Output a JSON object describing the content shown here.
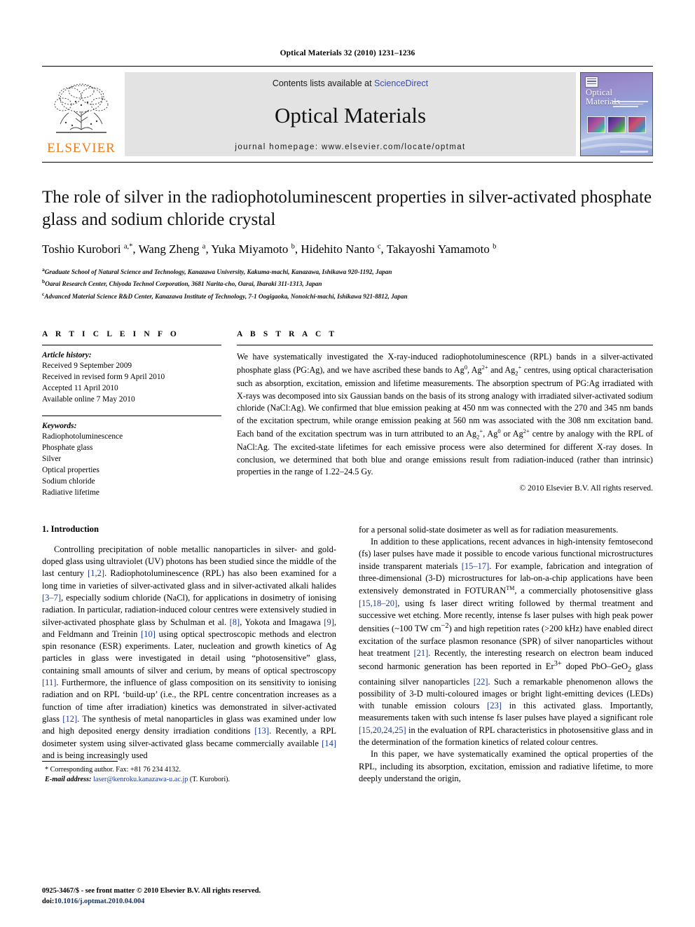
{
  "running_head": "Optical Materials 32 (2010) 1231–1236",
  "masthead": {
    "contents_prefix": "Contents lists available at ",
    "sciencedirect": "ScienceDirect",
    "journal_title": "Optical Materials",
    "homepage": "journal homepage: www.elsevier.com/locate/optmat",
    "publisher": "ELSEVIER",
    "cover_title": "Optical Materials",
    "accent_orange": "#F07D1A",
    "link_blue": "#3B4CA8"
  },
  "article": {
    "title": "The role of silver in the radiophotoluminescent properties in silver-activated phosphate glass and sodium chloride crystal",
    "authors_html": "Toshio Kurobori <sup>a,*</sup>, Wang Zheng <sup>a</sup>, Yuka Miyamoto <sup>b</sup>, Hidehito Nanto <sup>c</sup>, Takayoshi Yamamoto <sup>b</sup>",
    "affiliations": [
      {
        "marker": "a",
        "text": "Graduate School of Natural Science and Technology, Kanazawa University, Kakuma-machi, Kanazawa, Ishikawa 920-1192, Japan"
      },
      {
        "marker": "b",
        "text": "Oarai Research Center, Chiyoda Technol Corporation, 3681 Narita-cho, Oarai, Ibaraki 311-1313, Japan"
      },
      {
        "marker": "c",
        "text": "Advanced Material Science R&D Center, Kanazawa Institute of Technology, 7-1 Oogigaoka, Nonoichi-machi, Ishikawa 921-8812, Japan"
      }
    ]
  },
  "article_info": {
    "heading": "A R T I C L E   I N F O",
    "history_label": "Article history:",
    "history": [
      "Received 9 September 2009",
      "Received in revised form 9 April 2010",
      "Accepted 11 April 2010",
      "Available online 7 May 2010"
    ],
    "keywords_label": "Keywords:",
    "keywords": [
      "Radiophotoluminescence",
      "Phosphate glass",
      "Silver",
      "Optical properties",
      "Sodium chloride",
      "Radiative lifetime"
    ]
  },
  "abstract": {
    "heading": "A B S T R A C T",
    "text_html": "We have systematically investigated the X-ray-induced radiophotoluminescence (RPL) bands in a silver-activated phosphate glass (PG:Ag), and we have ascribed these bands to Ag<sup>0</sup>, Ag<sup>2+</sup> and Ag<sub>2</sub><sup>+</sup> centres, using optical characterisation such as absorption, excitation, emission and lifetime measurements. The absorption spectrum of PG:Ag irradiated with X-rays was decomposed into six Gaussian bands on the basis of its strong analogy with irradiated silver-activated sodium chloride (NaCl:Ag). We confirmed that blue emission peaking at 450 nm was connected with the 270 and 345 nm bands of the excitation spectrum, while orange emission peaking at 560 nm was associated with the 308 nm excitation band. Each band of the excitation spectrum was in turn attributed to an Ag<sub>2</sub><sup>+</sup>, Ag<sup>0</sup> or Ag<sup>2+</sup> centre by analogy with the RPL of NaCl:Ag. The excited-state lifetimes for each emissive process were also determined for different X-ray doses. In conclusion, we determined that both blue and orange emissions result from radiation-induced (rather than intrinsic) properties in the range of 1.22–24.5 Gy.",
    "copyright": "© 2010 Elsevier B.V. All rights reserved."
  },
  "body": {
    "section_heading": "1. Introduction",
    "left_paragraphs_html": [
      "Controlling precipitation of noble metallic nanoparticles in silver- and gold-doped glass using ultraviolet (UV) photons has been studied since the middle of the last century <span class=\"ref\">[1,2]</span>. Radiophotoluminescence (RPL) has also been examined for a long time in varieties of silver-activated glass and in silver-activated alkali halides <span class=\"ref\">[3–7]</span>, especially sodium chloride (NaCl), for applications in dosimetry of ionising radiation. In particular, radiation-induced colour centres were extensively studied in silver-activated phosphate glass by Schulman et al. <span class=\"ref\">[8]</span>, Yokota and Imagawa <span class=\"ref\">[9]</span>, and Feldmann and Treinin <span class=\"ref\">[10]</span> using optical spectroscopic methods and electron spin resonance (ESR) experiments. Later, nucleation and growth kinetics of Ag particles in glass were investigated in detail using “photosensitive” glass, containing small amounts of silver and cerium, by means of optical spectroscopy <span class=\"ref\">[11]</span>. Furthermore, the influence of glass composition on its sensitivity to ionising radiation and on RPL ‘build-up’ (i.e., the RPL centre concentration increases as a function of time after irradiation) kinetics was demonstrated in silver-activated glass <span class=\"ref\">[12]</span>. The synthesis of metal nanoparticles in glass was examined under low and high deposited energy density irradiation conditions <span class=\"ref\">[13]</span>. Recently, a RPL dosimeter system using silver-activated glass became commercially available <span class=\"ref\">[14]</span> and is being increasingly used"
    ],
    "right_paragraphs_html": [
      "for a personal solid-state dosimeter as well as for radiation measurements.",
      "In addition to these applications, recent advances in high-intensity femtosecond (fs) laser pulses have made it possible to encode various functional microstructures inside transparent materials <span class=\"ref\">[15–17]</span>. For example, fabrication and integration of three-dimensional (3-D) microstructures for lab-on-a-chip applications have been extensively demonstrated in FOTURAN<sup class=\"tm\">TM</sup>, a commercially photosensitive glass <span class=\"ref\">[15,18–20]</span>, using fs laser direct writing followed by thermal treatment and successive wet etching. More recently, intense fs laser pulses with high peak power densities (~100 TW cm<sup>−2</sup>) and high repetition rates (&gt;200 kHz) have enabled direct excitation of the surface plasmon resonance (SPR) of silver nanoparticles without heat treatment <span class=\"ref\">[21]</span>. Recently, the interesting research on electron beam induced second harmonic generation has been reported in Er<sup>3+</sup> doped PbO–GeO<sub>2</sub> glass containing silver nanoparticles <span class=\"ref\">[22]</span>. Such a remarkable phenomenon allows the possibility of 3-D multi-coloured images or bright light-emitting devices (LEDs) with tunable emission colours <span class=\"ref\">[23]</span> in this activated glass. Importantly, measurements taken with such intense fs laser pulses have played a significant role <span class=\"ref\">[15,20,24,25]</span> in the evaluation of RPL characteristics in photosensitive glass and in the determination of the formation kinetics of related colour centres.",
      "In this paper, we have systematically examined the optical properties of the RPL, including its absorption, excitation, emission and radiative lifetime, to more deeply understand the origin,"
    ]
  },
  "footnote": {
    "corresponding_html": "<span class=\"star\">*</span> Corresponding author. Fax: +81 76 234 4132.",
    "email_label": "E-mail address:",
    "email": "laser@kenroku.kanazawa-u.ac.jp",
    "email_owner": "(T. Kurobori)."
  },
  "page_footer": {
    "issn_line": "0925-3467/$ - see front matter © 2010 Elsevier B.V. All rights reserved.",
    "doi_prefix": "doi:",
    "doi": "10.1016/j.optmat.2010.04.004"
  }
}
